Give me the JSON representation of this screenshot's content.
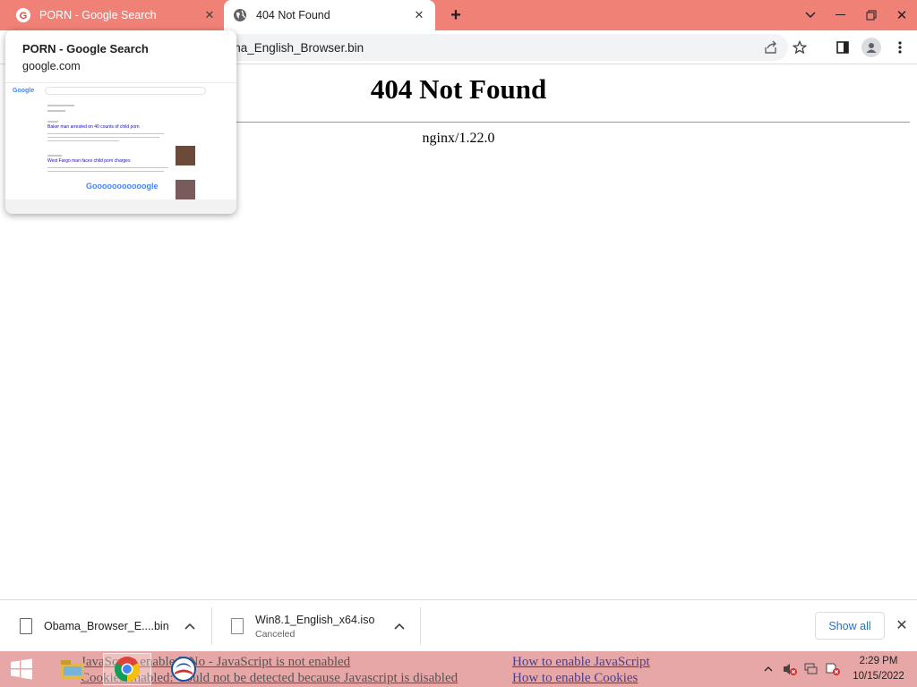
{
  "browser": {
    "tabs": [
      {
        "title": "PORN - Google Search",
        "favicon": "google-g-icon",
        "active": false
      },
      {
        "title": "404 Not Found",
        "favicon": "globe-icon",
        "active": true
      }
    ],
    "address_visible_text": "ama_English_Browser.bin"
  },
  "hovercard": {
    "title": "PORN - Google Search",
    "domain": "google.com",
    "thumb": {
      "logo": "Google",
      "result1": "Baker man arrested on 40 counts of child porn",
      "result2": "West Fargo man faces child porn charges",
      "pager": "Gooooooooooogle"
    }
  },
  "page": {
    "heading": "404 Not Found",
    "server": "nginx/1.22.0"
  },
  "downloads": {
    "items": [
      {
        "name": "Obama_Browser_E....bin",
        "status": ""
      },
      {
        "name": "Win8.1_English_x64.iso",
        "status": "Canceled"
      }
    ],
    "show_all": "Show all"
  },
  "taskbar": {
    "ghost_text": {
      "line1_left": "JavaScript enabled: No - JavaScript is not enabled",
      "line2_left": "Cookies enabled: Could not be detected because Javascript is disabled",
      "line1_right": "How to enable JavaScript",
      "line2_right": "How to enable Cookies"
    },
    "clock": {
      "time": "2:29 PM",
      "date": "10/15/2022"
    }
  }
}
